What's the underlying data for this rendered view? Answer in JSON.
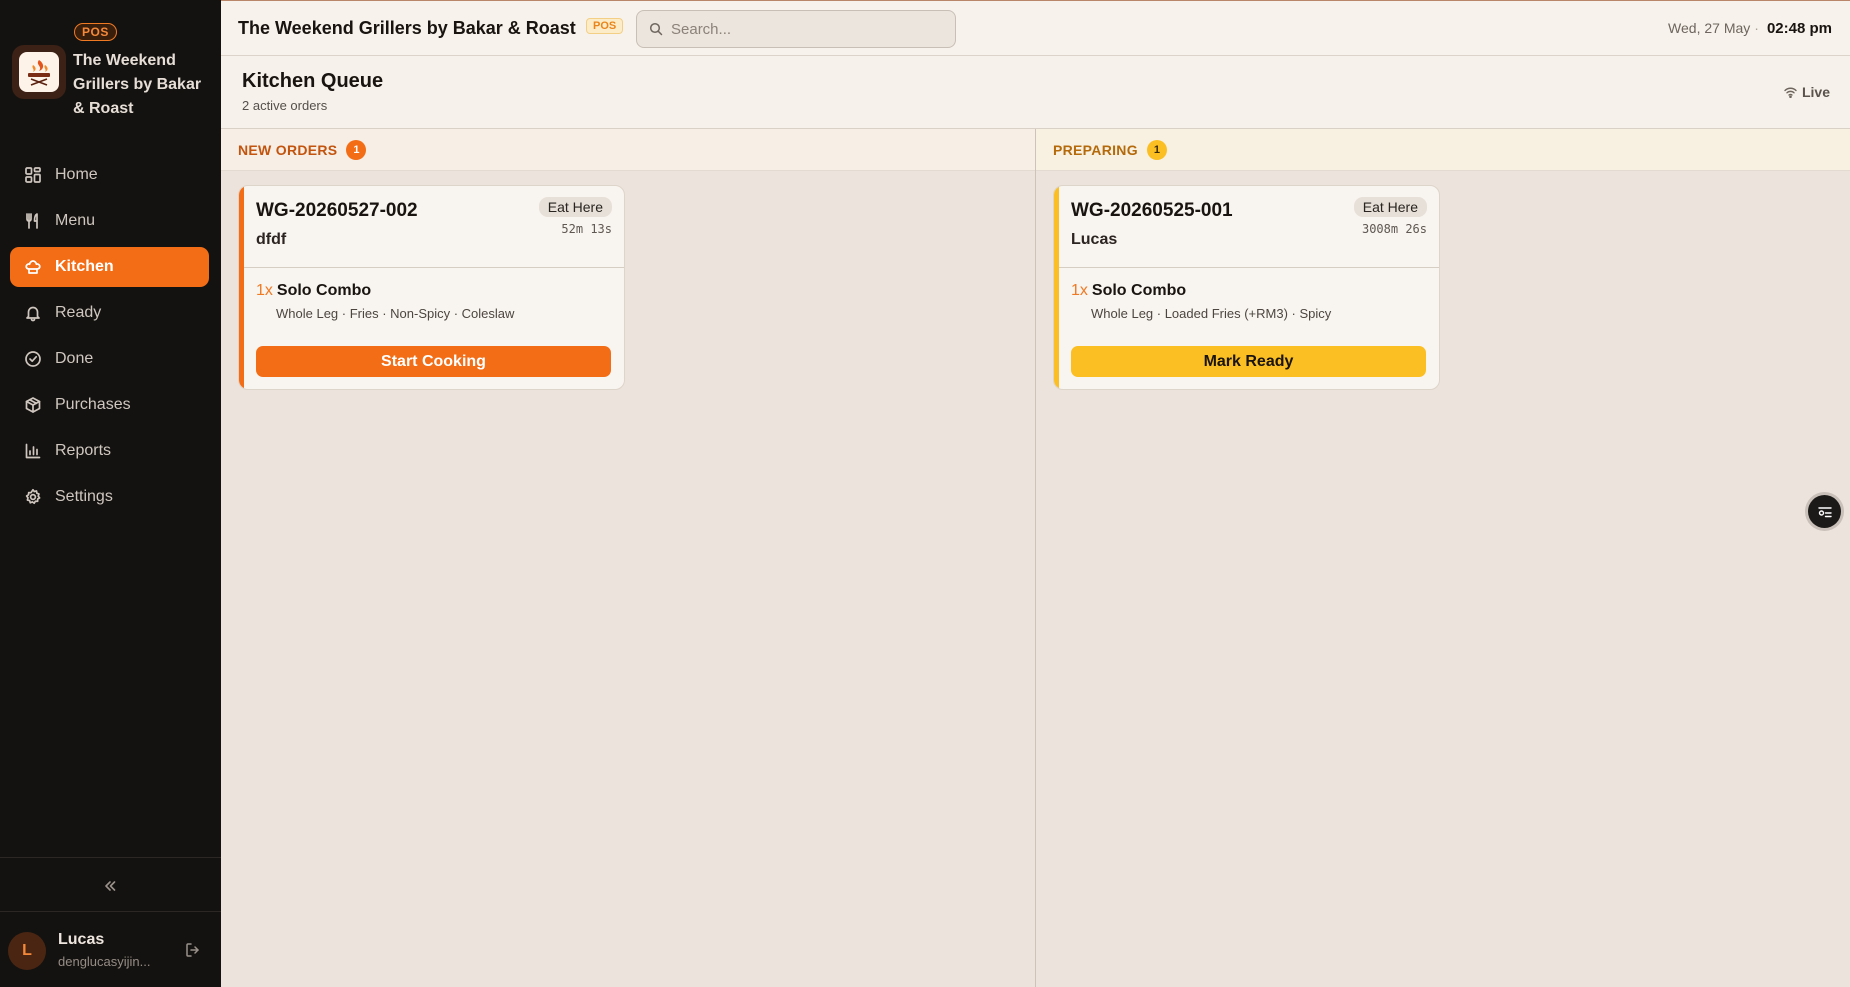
{
  "brand": {
    "badge": "POS",
    "name": "The Weekend Grillers by Bakar & Roast"
  },
  "sidebar": {
    "items": [
      {
        "label": "Home",
        "icon": "grid-icon"
      },
      {
        "label": "Menu",
        "icon": "utensils-icon"
      },
      {
        "label": "Kitchen",
        "icon": "chef-hat-icon",
        "active": true
      },
      {
        "label": "Ready",
        "icon": "bell-icon"
      },
      {
        "label": "Done",
        "icon": "check-circle-icon"
      },
      {
        "label": "Purchases",
        "icon": "package-icon"
      },
      {
        "label": "Reports",
        "icon": "bar-chart-icon"
      },
      {
        "label": "Settings",
        "icon": "gear-icon"
      }
    ],
    "user": {
      "initial": "L",
      "name": "Lucas",
      "email": "denglucasyijin..."
    }
  },
  "topbar": {
    "title": "The Weekend Grillers by Bakar & Roast",
    "badge": "POS",
    "search_placeholder": "Search...",
    "date": "Wed, 27 May",
    "time": "02:48 pm"
  },
  "page": {
    "title": "Kitchen Queue",
    "subtitle": "2 active orders",
    "status": "Live"
  },
  "columns": {
    "new": {
      "label": "NEW ORDERS",
      "count": "1",
      "order": {
        "id": "WG-20260527-002",
        "customer": "dfdf",
        "type": "Eat Here",
        "elapsed": "52m 13s",
        "qty": "1x",
        "item": "Solo Combo",
        "modifiers": "Whole Leg · Fries · Non-Spicy · Coleslaw",
        "action": "Start Cooking"
      }
    },
    "preparing": {
      "label": "PREPARING",
      "count": "1",
      "order": {
        "id": "WG-20260525-001",
        "customer": "Lucas",
        "type": "Eat Here",
        "elapsed": "3008m 26s",
        "qty": "1x",
        "item": "Solo Combo",
        "modifiers": "Whole Leg · Loaded Fries (+RM3) · Spicy",
        "action": "Mark Ready"
      }
    }
  },
  "colors": {
    "accent": "#f26d16",
    "preparing": "#fbbf24",
    "sidebar_bg": "#141210"
  }
}
